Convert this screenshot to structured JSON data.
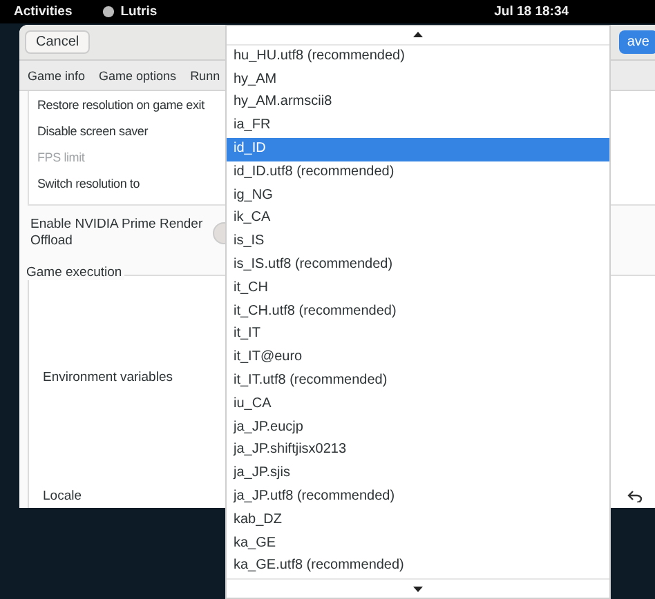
{
  "top_bar": {
    "activities": "Activities",
    "app_name": "Lutris",
    "clock": "Jul 18  18:34"
  },
  "dialog": {
    "cancel": "Cancel",
    "save": "ave",
    "tabs": [
      {
        "label": "Game info"
      },
      {
        "label": "Game options"
      },
      {
        "label": "Runn"
      }
    ],
    "display_rows": [
      {
        "label": "Restore resolution on game exit",
        "disabled": false
      },
      {
        "label": "Disable screen saver",
        "disabled": false
      },
      {
        "label": "FPS limit",
        "disabled": true
      },
      {
        "label": "Switch resolution to",
        "disabled": false
      }
    ],
    "nvidia_label": "Enable NVIDIA Prime Render Offload",
    "nvidia_switch_on": false,
    "game_execution": {
      "title": "Game execution",
      "rows": [
        "Environment variables",
        "Locale"
      ]
    }
  },
  "dropdown": {
    "items": [
      {
        "label": "hu_HU.utf8 (recommended)",
        "selected": false
      },
      {
        "label": "hy_AM",
        "selected": false
      },
      {
        "label": "hy_AM.armscii8",
        "selected": false
      },
      {
        "label": "ia_FR",
        "selected": false
      },
      {
        "label": "id_ID",
        "selected": true
      },
      {
        "label": "id_ID.utf8 (recommended)",
        "selected": false
      },
      {
        "label": "ig_NG",
        "selected": false
      },
      {
        "label": "ik_CA",
        "selected": false
      },
      {
        "label": "is_IS",
        "selected": false
      },
      {
        "label": "is_IS.utf8 (recommended)",
        "selected": false
      },
      {
        "label": "it_CH",
        "selected": false
      },
      {
        "label": "it_CH.utf8 (recommended)",
        "selected": false
      },
      {
        "label": "it_IT",
        "selected": false
      },
      {
        "label": "it_IT@euro",
        "selected": false
      },
      {
        "label": "it_IT.utf8 (recommended)",
        "selected": false
      },
      {
        "label": "iu_CA",
        "selected": false
      },
      {
        "label": "ja_JP.eucjp",
        "selected": false
      },
      {
        "label": "ja_JP.shiftjisx0213",
        "selected": false
      },
      {
        "label": "ja_JP.sjis",
        "selected": false
      },
      {
        "label": "ja_JP.utf8 (recommended)",
        "selected": false
      },
      {
        "label": "kab_DZ",
        "selected": false
      },
      {
        "label": "ka_GE",
        "selected": false
      },
      {
        "label": "ka_GE.utf8 (recommended)",
        "selected": false
      }
    ]
  }
}
